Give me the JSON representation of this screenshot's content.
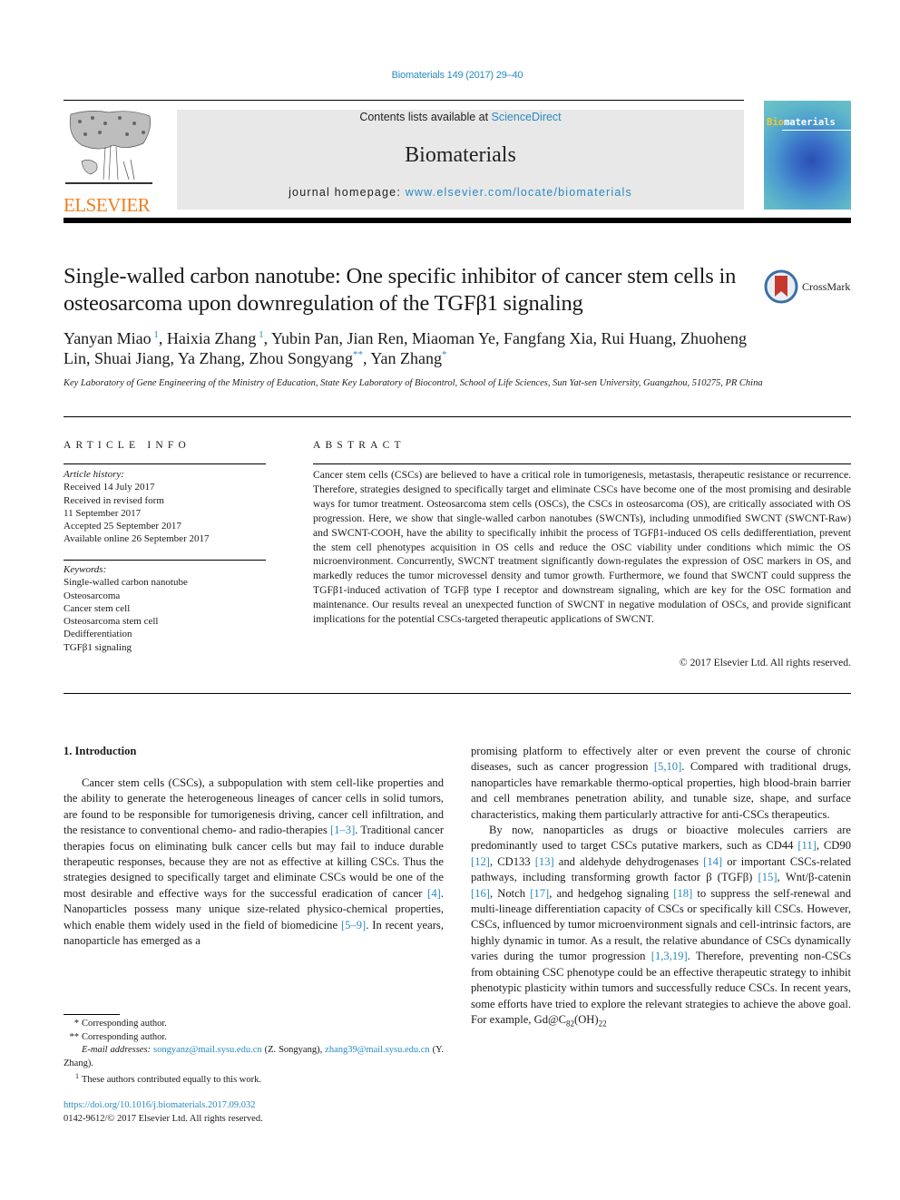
{
  "journal_ref": "Biomaterials 149 (2017) 29–40",
  "masthead": {
    "contents_prefix": "Contents lists available at ",
    "contents_link": "ScienceDirect",
    "journal_name": "Biomaterials",
    "homepage_prefix": "journal homepage: ",
    "homepage_link": "www.elsevier.com/locate/biomaterials"
  },
  "publisher_logo": "ELSEVIER",
  "cover": {
    "title_bio": "Bio",
    "title_rest": "materials"
  },
  "crossmark_label": "CrossMark",
  "title": "Single-walled carbon nanotube: One specific inhibitor of cancer stem cells in osteosarcoma upon downregulation of the TGFβ1 signaling",
  "authors": [
    {
      "name": "Yanyan Miao",
      "mark": "1"
    },
    {
      "name": "Haixia Zhang",
      "mark": "1"
    },
    {
      "name": "Yubin Pan",
      "mark": ""
    },
    {
      "name": "Jian Ren",
      "mark": ""
    },
    {
      "name": "Miaoman Ye",
      "mark": ""
    },
    {
      "name": "Fangfang Xia",
      "mark": ""
    },
    {
      "name": "Rui Huang",
      "mark": ""
    },
    {
      "name": "Zhuoheng Lin",
      "mark": ""
    },
    {
      "name": "Shuai Jiang",
      "mark": ""
    },
    {
      "name": "Ya Zhang",
      "mark": ""
    },
    {
      "name": "Zhou Songyang",
      "mark": "**"
    },
    {
      "name": "Yan Zhang",
      "mark": "*"
    }
  ],
  "affiliation": "Key Laboratory of Gene Engineering of the Ministry of Education, State Key Laboratory of Biocontrol, School of Life Sciences, Sun Yat-sen University, Guangzhou, 510275, PR China",
  "article_info": {
    "heading": "ARTICLE INFO",
    "history_label": "Article history:",
    "history": [
      "Received 14 July 2017",
      "Received in revised form",
      "11 September 2017",
      "Accepted 25 September 2017",
      "Available online 26 September 2017"
    ],
    "keywords_label": "Keywords:",
    "keywords": [
      "Single-walled carbon nanotube",
      "Osteosarcoma",
      "Cancer stem cell",
      "Osteosarcoma stem cell",
      "Dedifferentiation",
      "TGFβ1 signaling"
    ]
  },
  "abstract": {
    "heading": "ABSTRACT",
    "text": "Cancer stem cells (CSCs) are believed to have a critical role in tumorigenesis, metastasis, therapeutic resistance or recurrence. Therefore, strategies designed to specifically target and eliminate CSCs have become one of the most promising and desirable ways for tumor treatment. Osteosarcoma stem cells (OSCs), the CSCs in osteosarcoma (OS), are critically associated with OS progression. Here, we show that single-walled carbon nanotubes (SWCNTs), including unmodified SWCNT (SWCNT-Raw) and SWCNT-COOH, have the ability to specifically inhibit the process of TGFβ1-induced OS cells dedifferentiation, prevent the stem cell phenotypes acquisition in OS cells and reduce the OSC viability under conditions which mimic the OS microenvironment. Concurrently, SWCNT treatment significantly down-regulates the expression of OSC markers in OS, and markedly reduces the tumor microvessel density and tumor growth. Furthermore, we found that SWCNT could suppress the TGFβ1-induced activation of TGFβ type I receptor and downstream signaling, which are key for the OSC formation and maintenance. Our results reveal an unexpected function of SWCNT in negative modulation of OSCs, and provide significant implications for the potential CSCs-targeted therapeutic applications of SWCNT.",
    "copyright": "© 2017 Elsevier Ltd. All rights reserved."
  },
  "introduction": {
    "heading": "1.  Introduction",
    "left_paragraph": [
      {
        "t": "Cancer stem cells (CSCs), a subpopulation with stem cell-like properties and the ability to generate the heterogeneous lineages of cancer cells in solid tumors, are found to be responsible for tumorigenesis driving, cancer cell infiltration, and the resistance to conventional chemo- and radio-therapies "
      },
      {
        "c": "[1–3]"
      },
      {
        "t": ". Traditional cancer therapies focus on eliminating bulk cancer cells but may fail to induce durable therapeutic responses, because they are not as effective at killing CSCs. Thus the strategies designed to specifically target and eliminate CSCs would be one of the most desirable and effective ways for the successful eradication of cancer "
      },
      {
        "c": "[4]"
      },
      {
        "t": ". Nanoparticles possess many unique size-related physico-chemical properties, which enable them widely used in the field of biomedicine "
      },
      {
        "c": "[5–9]"
      },
      {
        "t": ". In recent years, nanoparticle has emerged as a"
      }
    ],
    "right_paragraph_1": [
      {
        "t": "promising platform to effectively alter or even prevent the course of chronic diseases, such as cancer progression "
      },
      {
        "c": "[5,10]"
      },
      {
        "t": ". Compared with traditional drugs, nanoparticles have remarkable thermo-optical properties, high blood-brain barrier and cell membranes penetration ability, and tunable size, shape, and surface characteristics, making them particularly attractive for anti-CSCs therapeutics."
      }
    ],
    "right_paragraph_2": [
      {
        "t": "By now, nanoparticles as drugs or bioactive molecules carriers are predominantly used to target CSCs putative markers, such as CD44 "
      },
      {
        "c": "[11]"
      },
      {
        "t": ", CD90 "
      },
      {
        "c": "[12]"
      },
      {
        "t": ", CD133 "
      },
      {
        "c": "[13]"
      },
      {
        "t": " and aldehyde dehydrogenases "
      },
      {
        "c": "[14]"
      },
      {
        "t": " or important CSCs-related pathways, including transforming growth factor β (TGFβ) "
      },
      {
        "c": "[15]"
      },
      {
        "t": ", Wnt/β-catenin "
      },
      {
        "c": "[16]"
      },
      {
        "t": ", Notch "
      },
      {
        "c": "[17]"
      },
      {
        "t": ", and hedgehog signaling "
      },
      {
        "c": "[18]"
      },
      {
        "t": " to suppress the self-renewal and multi-lineage differentiation capacity of CSCs or specifically kill CSCs. However, CSCs, influenced by tumor microenvironment signals and cell-intrinsic factors, are highly dynamic in tumor. As a result, the relative abundance of CSCs dynamically varies during the tumor progression "
      },
      {
        "c": "[1,3,19]"
      },
      {
        "t": ". Therefore, preventing non-CSCs from obtaining CSC phenotype could be an effective therapeutic strategy to inhibit phenotypic plasticity within tumors and successfully reduce CSCs. In recent years, some efforts have tried to explore the relevant strategies to achieve the above goal. For example, Gd@C"
      },
      {
        "sub": "82"
      },
      {
        "t": "(OH)"
      },
      {
        "sub": "22"
      }
    ]
  },
  "footnotes": {
    "fn1_mark": "*",
    "fn1_text": "Corresponding author.",
    "fn2_mark": "**",
    "fn2_text": "Corresponding author.",
    "email_label": "E-mail addresses: ",
    "email1": "songyanz@mail.sysu.edu.cn",
    "email1_owner": " (Z. Songyang), ",
    "email2": "zhang39@mail.sysu.edu.cn",
    "email2_owner": " (Y. Zhang).",
    "fn3_mark": "1",
    "fn3_text": "These authors contributed equally to this work."
  },
  "doi": "https://doi.org/10.1016/j.biomaterials.2017.09.032",
  "issn_copyright": "0142-9612/© 2017 Elsevier Ltd. All rights reserved.",
  "colors": {
    "link": "#2a8bc0",
    "elsevier_orange": "#f07e1e",
    "masthead_bg": "#e8e8e8"
  }
}
